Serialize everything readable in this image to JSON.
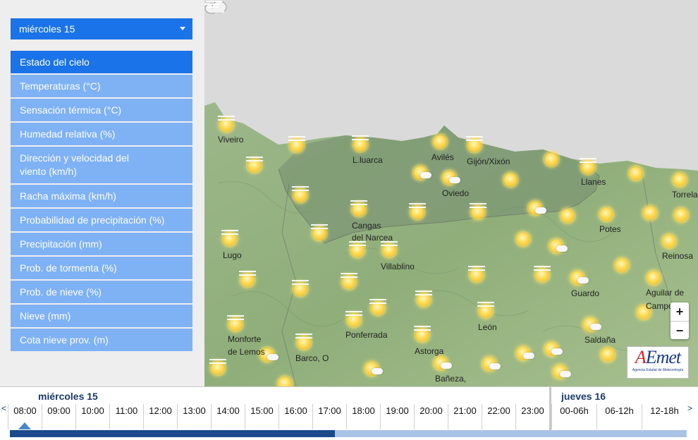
{
  "sidebar": {
    "day_select": {
      "value": "miércoles 15"
    },
    "menu": [
      "Estado del cielo",
      "Temperaturas (°C)",
      "Sensación térmica (°C)",
      "Humedad relativa (%)",
      "Dirección y velocidad del viento (km/h)",
      "Racha máxima (km/h)",
      "Probabilidad de precipitación (%)",
      "Precipitación (mm)",
      "Prob. de tormenta (%)",
      "Prob. de nieve (%)",
      "Nieve (mm)",
      "Cota nieve prov. (m)"
    ],
    "active_index": 0
  },
  "map": {
    "places": [
      "Viveiro",
      "L.luarca",
      "Avilés",
      "Gijón/Xixón",
      "Oviedo",
      "Llanes",
      "Torrela",
      "Cangas",
      "del Narcea",
      "Potes",
      "Reinosa",
      "Lugo",
      "Villablino",
      "Guardo",
      "Aguilar de",
      "Campo",
      "Monforte",
      "de Lemos",
      "Ponferrada",
      "León",
      "Saldaña",
      "Barco, O",
      "Astorga",
      "Bañeza,"
    ],
    "zoom_in": "+",
    "zoom_out": "−",
    "logo": {
      "brand_a": "A",
      "brand_rest": "Emet",
      "subtitle": "Agencia Estatal de Meteorología"
    }
  },
  "timeline": {
    "day1": "miércoles 15",
    "day2": "jueves 16",
    "prev": "<",
    "next": ">",
    "hours": [
      "08:00",
      "09:00",
      "10:00",
      "11:00",
      "12:00",
      "13:00",
      "14:00",
      "15:00",
      "16:00",
      "17:00",
      "18:00",
      "19:00",
      "20:00",
      "21:00",
      "22:00",
      "23:00"
    ],
    "ranges": [
      "00-06h",
      "06-12h",
      "12-18h"
    ],
    "selected_hour": "08:00",
    "progress": 0.48
  },
  "colors": {
    "accent": "#1a73e8",
    "menu_item": "#7fb1f5",
    "timeline_text": "#1b3a6b",
    "track_fill": "#1a4a8c"
  }
}
